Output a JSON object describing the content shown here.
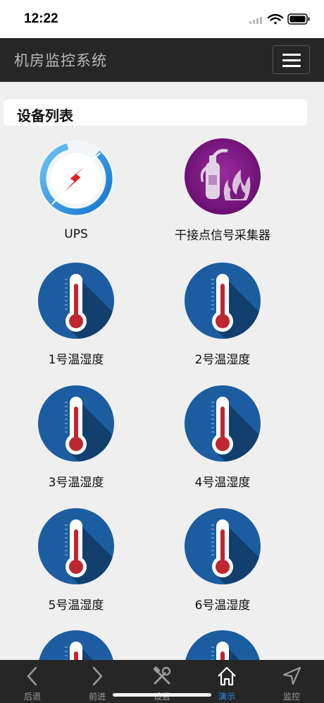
{
  "status_bar": {
    "time": "12:22"
  },
  "header": {
    "title": "机房监控系统"
  },
  "panel": {
    "title": "设备列表"
  },
  "devices": [
    {
      "label": "UPS",
      "icon": "ups-lightning-icon"
    },
    {
      "label": "干接点信号采集器",
      "icon": "fire-extinguisher-icon"
    },
    {
      "label": "1号温湿度",
      "icon": "thermometer-icon"
    },
    {
      "label": "2号温湿度",
      "icon": "thermometer-icon"
    },
    {
      "label": "3号温湿度",
      "icon": "thermometer-icon"
    },
    {
      "label": "4号温湿度",
      "icon": "thermometer-icon"
    },
    {
      "label": "5号温湿度",
      "icon": "thermometer-icon"
    },
    {
      "label": "6号温湿度",
      "icon": "thermometer-icon"
    },
    {
      "label": "",
      "icon": "thermometer-icon"
    },
    {
      "label": "",
      "icon": "thermometer-icon"
    }
  ],
  "tab_bar": {
    "tabs": [
      {
        "label": "后退",
        "icon": "chevron-left-icon",
        "active": false
      },
      {
        "label": "前进",
        "icon": "chevron-right-icon",
        "active": false
      },
      {
        "label": "设置",
        "icon": "tools-icon",
        "active": false
      },
      {
        "label": "演示",
        "icon": "home-icon",
        "active": true
      },
      {
        "label": "监控",
        "icon": "navigation-arrow-icon",
        "active": false
      }
    ]
  },
  "colors": {
    "nav_background": "#262626",
    "active_tab": "#2f8ff0",
    "page_background": "#efefef"
  }
}
